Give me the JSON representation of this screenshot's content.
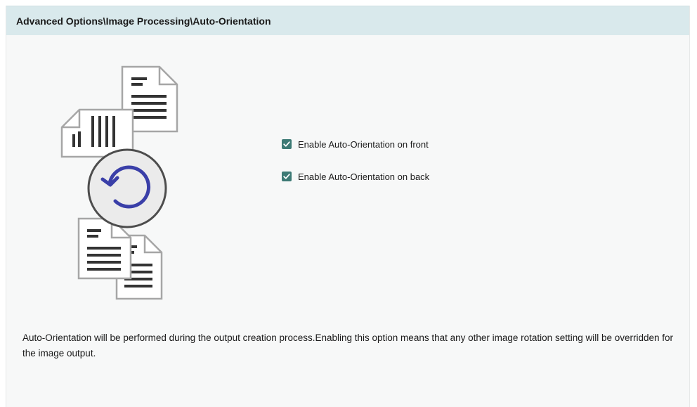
{
  "header": {
    "title": "Advanced Options\\Image Processing\\Auto-Orientation"
  },
  "options": [
    {
      "label": "Enable Auto-Orientation on front",
      "checked": true
    },
    {
      "label": "Enable Auto-Orientation on back",
      "checked": true
    }
  ],
  "description": "Auto-Orientation will be performed during the output creation process.Enabling this option means that any other image rotation setting will be overridden for the image output.",
  "colors": {
    "header_bg": "#d9e9ec",
    "checkbox": "#3d7a75",
    "rotate_arrow": "#3a3fa8"
  },
  "icons": {
    "illustration": "auto-orientation-illustration"
  }
}
